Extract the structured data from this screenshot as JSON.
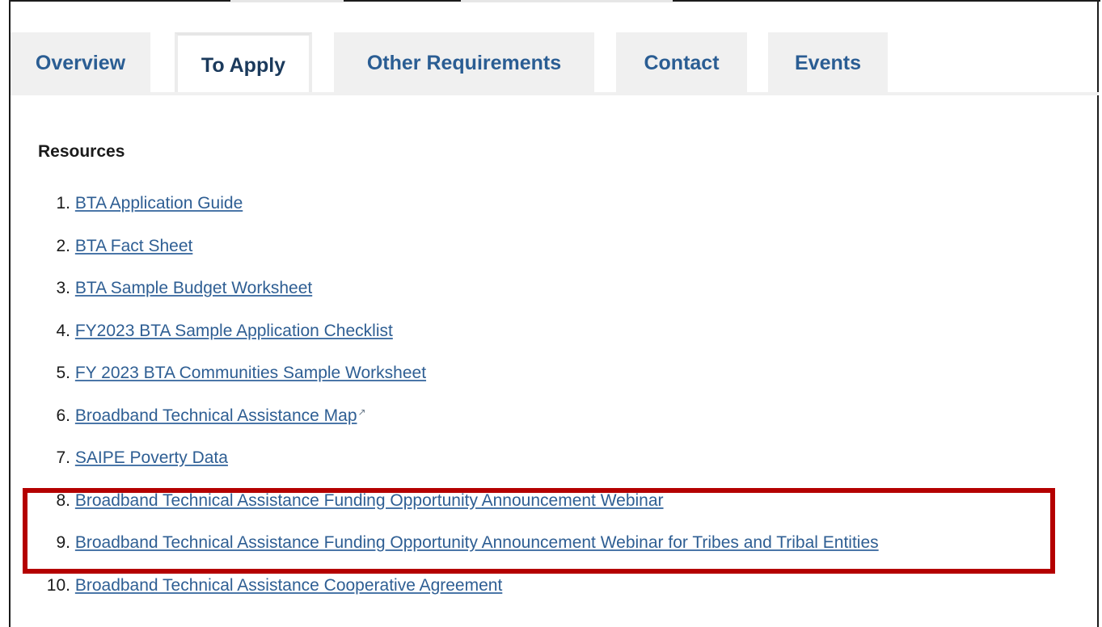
{
  "tabs": [
    {
      "label": "Overview",
      "active": false
    },
    {
      "label": "To Apply",
      "active": true
    },
    {
      "label": "Other Requirements",
      "active": false
    },
    {
      "label": "Contact",
      "active": false
    },
    {
      "label": "Events",
      "active": false
    }
  ],
  "resources": {
    "heading": "Resources",
    "items": [
      {
        "num": "1.",
        "label": "BTA Application Guide"
      },
      {
        "num": "2.",
        "label": "BTA Fact Sheet"
      },
      {
        "num": "3.",
        "label": "BTA Sample Budget Worksheet"
      },
      {
        "num": "4.",
        "label": "FY2023 BTA Sample Application Checklist"
      },
      {
        "num": "5.",
        "label": "FY 2023 BTA Communities Sample Worksheet"
      },
      {
        "num": "6.",
        "label": "Broadband Technical Assistance Map",
        "external": true
      },
      {
        "num": "7.",
        "label": "SAIPE Poverty Data"
      },
      {
        "num": "8.",
        "label": "Broadband Technical Assistance Funding Opportunity Announcement Webinar"
      },
      {
        "num": "9.",
        "label": "Broadband Technical Assistance Funding Opportunity Announcement Webinar for Tribes and Tribal Entities"
      },
      {
        "num": "10.",
        "label": "Broadband Technical Assistance Cooperative Agreement"
      }
    ]
  },
  "colors": {
    "tab_text": "#2a5d93",
    "tab_bg": "#f0f0f0",
    "link": "#2e5e93",
    "highlight_border": "#b40000"
  },
  "icons": {
    "external_link": "external-link-icon"
  }
}
